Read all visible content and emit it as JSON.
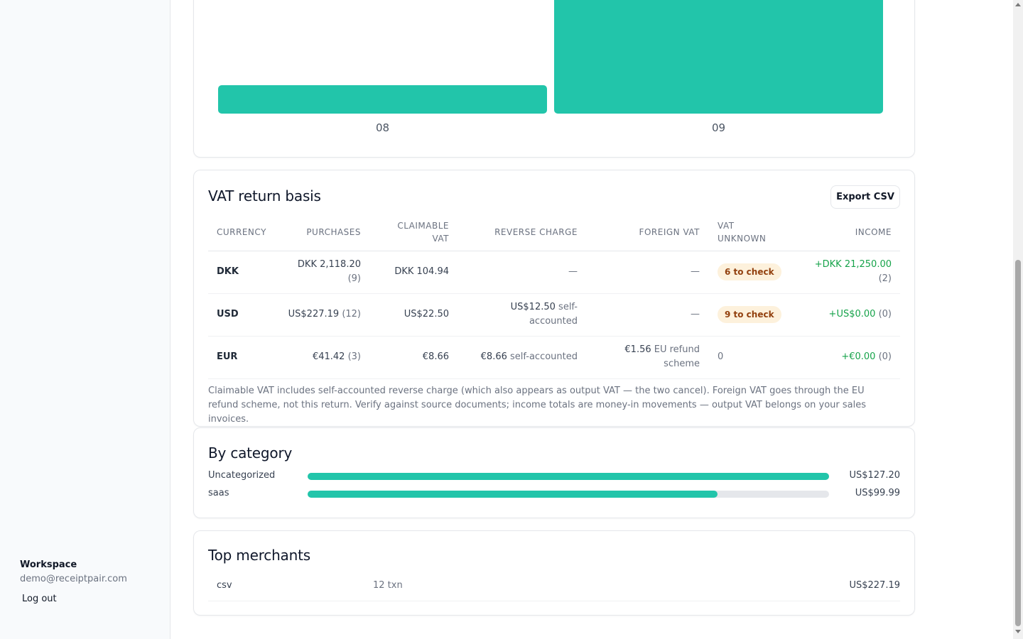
{
  "sidebar": {
    "workspace_label": "Workspace",
    "email": "demo@receiptpair.com",
    "logout": "Log out"
  },
  "chart_data": {
    "type": "bar",
    "categories": [
      "08",
      "09"
    ],
    "values": [
      20,
      100
    ],
    "value_scale": "relative",
    "title": "",
    "xlabel": "",
    "ylabel": "",
    "ylim": [
      0,
      100
    ],
    "grid": false,
    "color": "#22c5aa"
  },
  "vat": {
    "title": "VAT return basis",
    "export_label": "Export CSV",
    "headers": {
      "currency": "CURRENCY",
      "purchases": "PURCHASES",
      "claimable_1": "CLAIMABLE",
      "claimable_2": "VAT",
      "reverse": "REVERSE CHARGE",
      "foreign": "FOREIGN VAT",
      "unknown_1": "VAT",
      "unknown_2": "UNKNOWN",
      "income": "INCOME"
    },
    "rows": [
      {
        "currency": "DKK",
        "purchases_amount": "DKK 2,118.20",
        "purchases_count": "(9)",
        "claimable": "DKK 104.94",
        "reverse": "—",
        "foreign": "—",
        "unknown_badge": "6 to check",
        "income_amount": "+DKK 21,250.00",
        "income_count": "(2)"
      },
      {
        "currency": "USD",
        "purchases_amount": "US$227.19",
        "purchases_count": "(12)",
        "claimable": "US$22.50",
        "reverse_amount": "US$12.50",
        "reverse_note_1": "self-",
        "reverse_note_2": "accounted",
        "foreign": "—",
        "unknown_badge": "9 to check",
        "income_amount": "+US$0.00",
        "income_count": "(0)"
      },
      {
        "currency": "EUR",
        "purchases_amount": "€41.42",
        "purchases_count": "(3)",
        "claimable": "€8.66",
        "reverse_amount": "€8.66",
        "reverse_note": "self-accounted",
        "foreign_amount": "€1.56",
        "foreign_note_1": "EU refund",
        "foreign_note_2": "scheme",
        "unknown": "0",
        "income_amount": "+€0.00",
        "income_count": "(0)"
      }
    ],
    "note": "Claimable VAT includes self-accounted reverse charge (which also appears as output VAT — the two cancel). Foreign VAT goes through the EU refund scheme, not this return. Verify against source documents; income totals are money-in movements — output VAT belongs on your sales invoices."
  },
  "category": {
    "title": "By category",
    "items": [
      {
        "label": "Uncategorized",
        "amount": "US$127.20",
        "fraction": 1.0
      },
      {
        "label": "saas",
        "amount": "US$99.99",
        "fraction": 0.786
      }
    ]
  },
  "merchants": {
    "title": "Top merchants",
    "items": [
      {
        "name": "csv",
        "txn": "12 txn",
        "amount": "US$227.19"
      }
    ]
  },
  "colors": {
    "accent": "#22c5aa",
    "badge_bg": "#fdf1dc",
    "badge_text": "#92400e",
    "income": "#16a34a"
  }
}
